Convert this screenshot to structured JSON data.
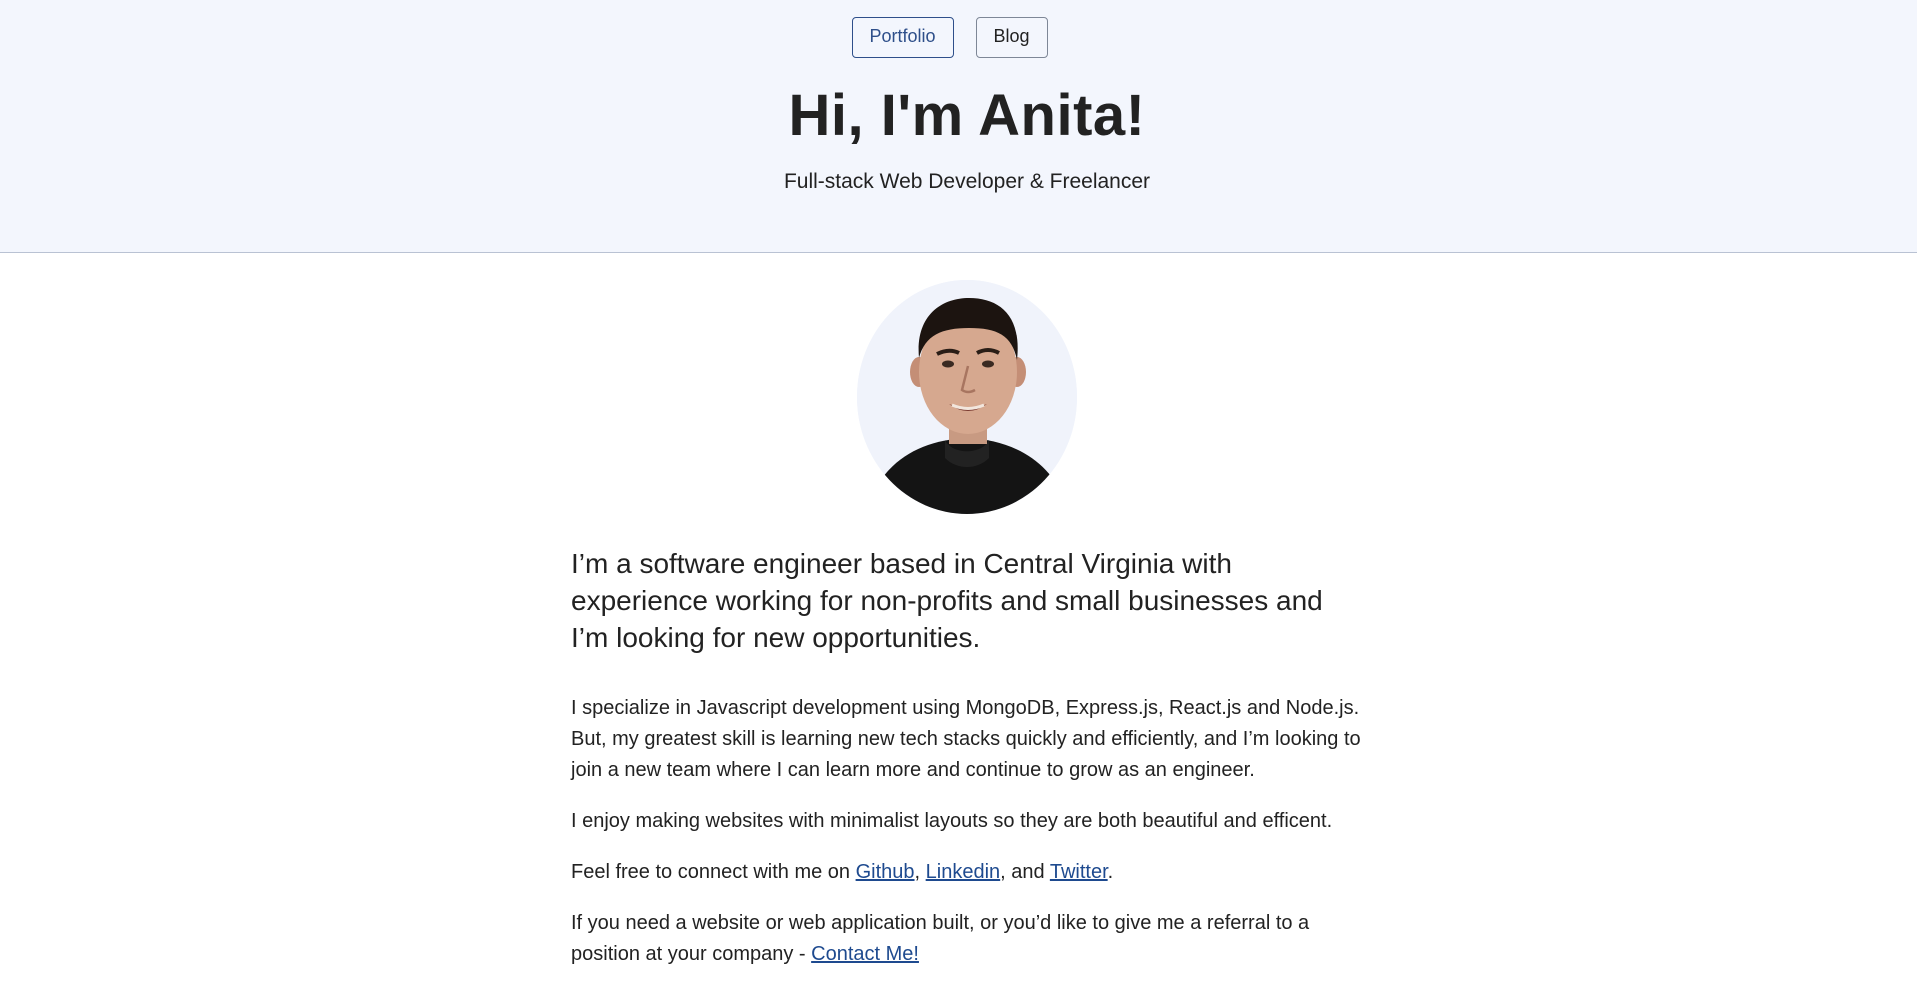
{
  "nav": {
    "portfolio_label": "Portfolio",
    "blog_label": "Blog"
  },
  "hero": {
    "title": "Hi, I'm Anita!",
    "subtitle": "Full-stack Web Developer & Freelancer"
  },
  "content": {
    "lead": "I’m a software engineer based in Central Virginia with experience working for non-profits and small businesses and I’m looking for new opportunities.",
    "para1": "I specialize in Javascript development using MongoDB, Express.js, React.js and Node.js. But, my greatest skill is learning new tech stacks quickly and efficiently, and I’m looking to join a new team where I can learn more and continue to grow as an engineer.",
    "para2": "I enjoy making websites with minimalist layouts so they are both beautiful and efficent.",
    "para3": {
      "prefix": "Feel free to connect with me on ",
      "github": "Github",
      "sep1": ", ",
      "linkedin": "Linkedin",
      "sep2": ", and ",
      "twitter": "Twitter",
      "suffix": "."
    },
    "para4": {
      "prefix": "If you need a website or web application built, or you’d like to give me a referral to a position at your company - ",
      "contact": "Contact Me!"
    }
  },
  "colors": {
    "hero_bg": "#f3f6fd",
    "link": "#1e4a8f",
    "text": "#222222"
  }
}
